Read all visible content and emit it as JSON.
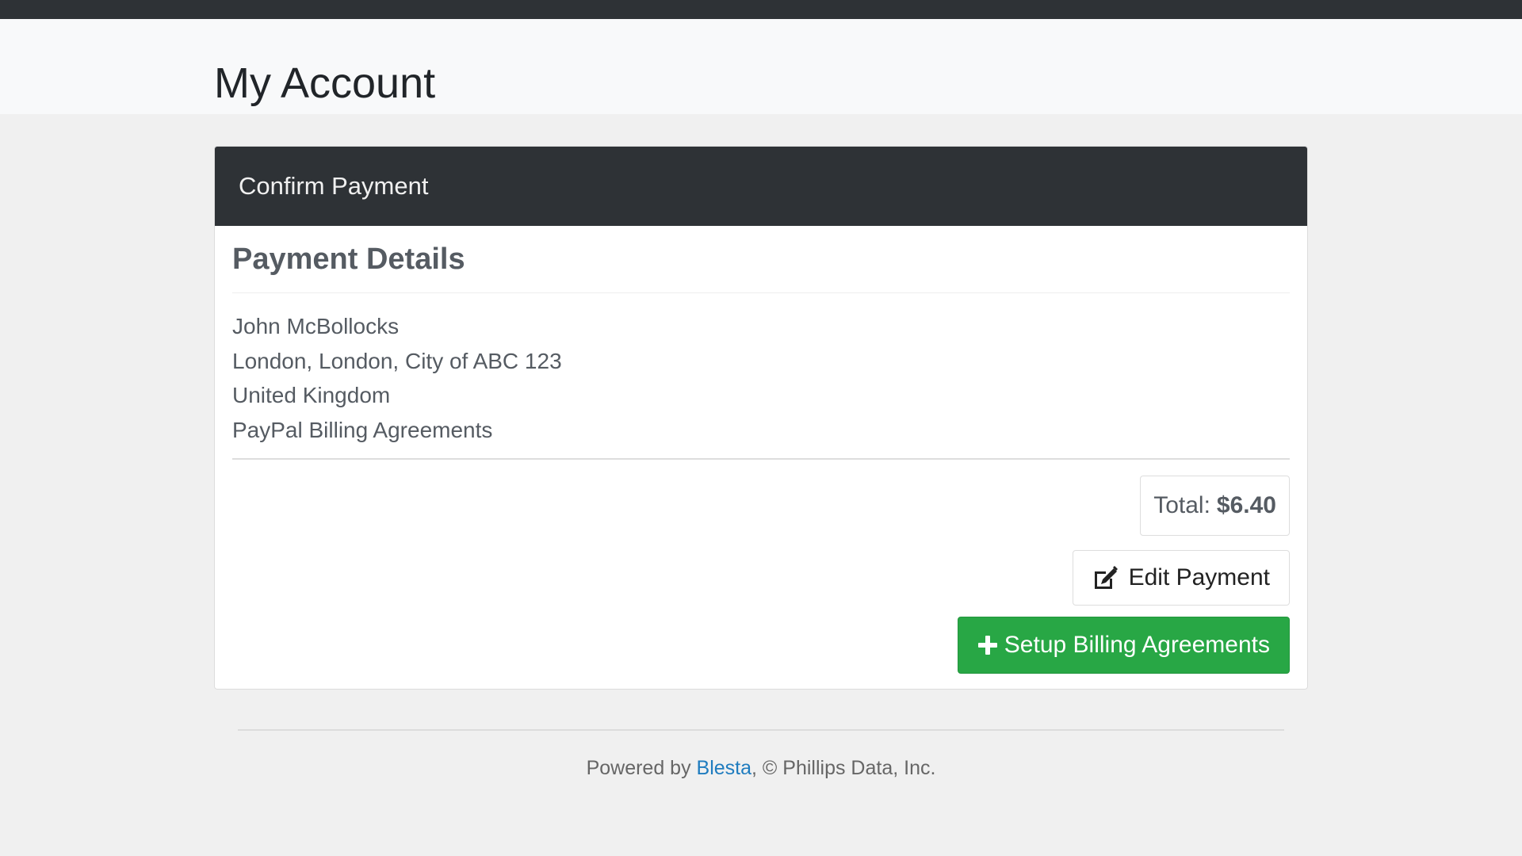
{
  "header": {
    "title": "My Account"
  },
  "card": {
    "title": "Confirm Payment",
    "section_title": "Payment Details",
    "address_lines": [
      "John McBollocks",
      "London, London, City of ABC 123",
      "United Kingdom",
      "PayPal Billing Agreements"
    ],
    "total_label": "Total:",
    "total_value": "$6.40",
    "edit_button_label": "Edit Payment",
    "setup_button_label": "Setup Billing Agreements"
  },
  "footer": {
    "prefix": "Powered by ",
    "link_text": "Blesta",
    "suffix": ", © Phillips Data, Inc."
  },
  "colors": {
    "topbar": "#2e3236",
    "card_header": "#2e3236",
    "success": "#28a745",
    "link": "#1f7cbf"
  },
  "icons": {
    "edit": "edit-icon",
    "plus": "plus-icon"
  }
}
